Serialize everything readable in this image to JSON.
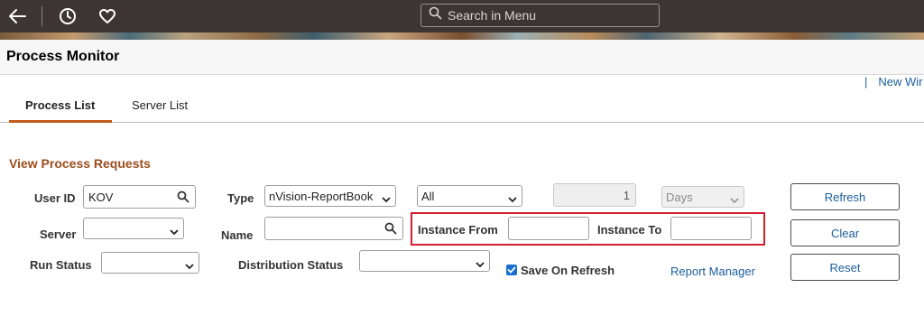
{
  "topbar": {
    "search_placeholder": "Search in Menu"
  },
  "page": {
    "title": "Process Monitor",
    "new_window": "New Wir"
  },
  "tabs": [
    {
      "label": "Process List",
      "active": true
    },
    {
      "label": "Server List",
      "active": false
    }
  ],
  "section_title": "View Process Requests",
  "form": {
    "user_id_label": "User ID",
    "user_id_value": "KOV",
    "type_label": "Type",
    "type_value": "nVision-ReportBook",
    "all_value": "All",
    "last_value": "1",
    "days_value": "Days",
    "server_label": "Server",
    "server_value": "",
    "name_label": "Name",
    "name_value": "",
    "instance_from_label": "Instance From",
    "instance_from_value": "",
    "instance_to_label": "Instance To",
    "instance_to_value": "",
    "run_status_label": "Run Status",
    "run_status_value": "",
    "distribution_status_label": "Distribution Status",
    "distribution_status_value": "",
    "save_on_refresh_label": "Save On Refresh",
    "save_on_refresh_checked": true,
    "report_manager_label": "Report Manager"
  },
  "buttons": {
    "refresh": "Refresh",
    "clear": "Clear",
    "reset": "Reset"
  },
  "colors": {
    "topbar": "#3d3533",
    "section_title": "#9b4d1e",
    "tab_underline": "#c05a1a",
    "link": "#1b5e9c",
    "highlight": "#d3202f"
  }
}
